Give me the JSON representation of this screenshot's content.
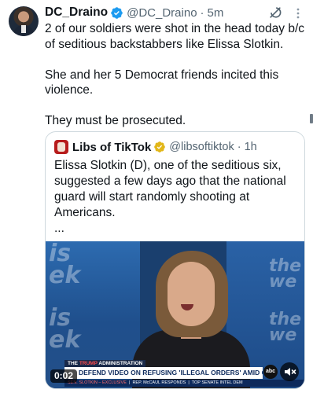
{
  "tweet": {
    "author_name": "DC_Draino",
    "author_handle": "@DC_Draino",
    "separator": "·",
    "time": "5m",
    "body_lines": [
      "2 of our soldiers were shot in the head today b/c of seditious backstabbers like Elissa Slotkin.",
      "She and her 5 Democrat friends incited this violence.",
      "They must be prosecuted."
    ]
  },
  "quote": {
    "author_name": "Libs of TikTok",
    "author_handle": "@libsoftiktok",
    "separator": "·",
    "time": "1h",
    "text": "Elissa Slotkin (D), one of the seditious six, suggested a few days ago that the national guard will start randomly shooting at Americans.",
    "ellipsis": "..."
  },
  "video": {
    "timecode": "0:02",
    "wall_text_1": "is\nek",
    "wall_text_2": "the\nwe",
    "admin_tag_prefix": "THE",
    "admin_tag_highlight": "TRUMP",
    "admin_tag_suffix": "ADMINISTRATION",
    "headline": "DEFEND VIDEO ON REFUSING 'ILLEGAL ORDERS' AMID GOP BACKLASH",
    "ticker_left": "SEN. SLOTKIN – EXCLUSIVE",
    "ticker_mid": "REP. McCAUL RESPONDS",
    "ticker_right": "TOP SENATE INTEL DEM",
    "network_logo": "abc"
  },
  "colors": {
    "verified_blue": "#1d9bf0",
    "verified_gold": "#e2b719",
    "text_secondary": "#536471"
  },
  "icons": {
    "verified": "verified-badge-icon",
    "grok": "grok-icon",
    "more": "more-options-icon",
    "mute": "mute-icon"
  }
}
